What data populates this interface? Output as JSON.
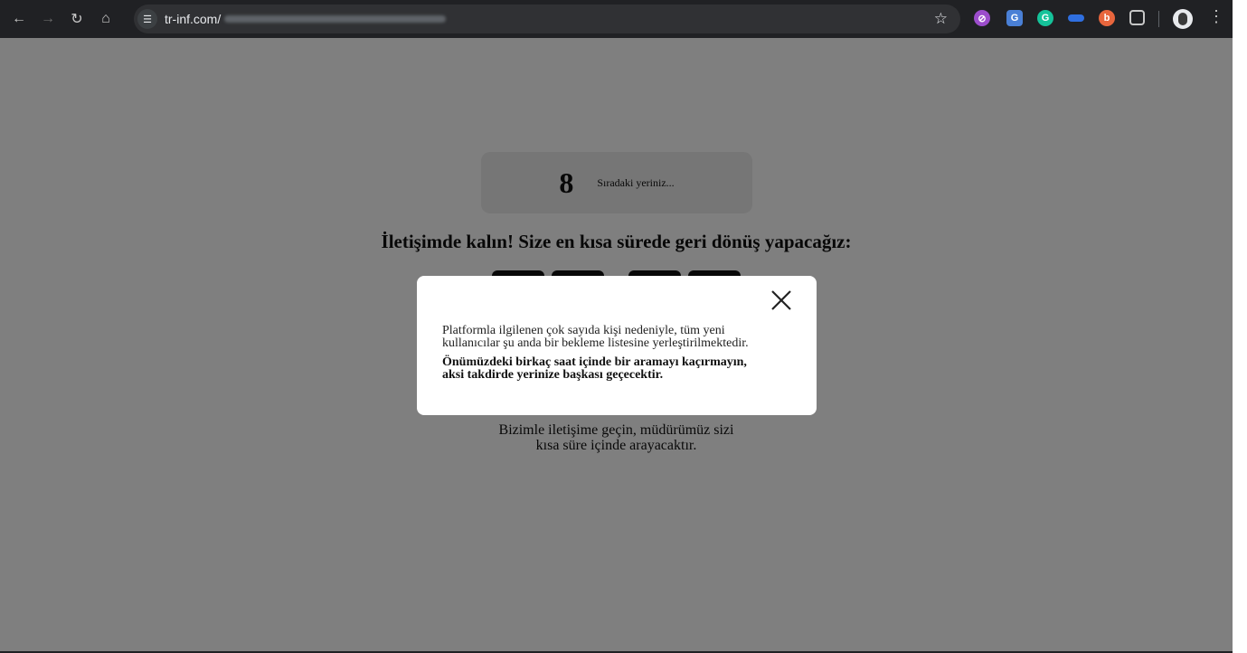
{
  "browser": {
    "url_host": "tr-inf.com/",
    "icons": [
      "back-icon",
      "forward-icon",
      "reload-icon",
      "home-icon",
      "site-settings-icon",
      "bookmark-star-icon",
      "extensions-icon",
      "profile-avatar",
      "menu-kebab-icon"
    ]
  },
  "page": {
    "queue_number": "8",
    "queue_text": "Sıradaki yeriniz...",
    "headline": "İletişimde kalın! Size en kısa sürede geri dönüş yapacağız:",
    "contact_line_1": "Bizimle iletişime geçin, müdürümüz sizi",
    "contact_line_2": "kısa süre içinde arayacaktır."
  },
  "modal": {
    "paragraph_1_line_1": "Platformla ilgilenen çok sayıda kişi nedeniyle, tüm yeni",
    "paragraph_1_line_2": "kullanıcılar şu anda bir bekleme listesine yerleştirilmektedir.",
    "paragraph_2_line_1": "Önümüzdeki birkaç saat içinde bir aramayı kaçırmayın,",
    "paragraph_2_line_2": "aksi takdirde yerinize başkası geçecektir."
  },
  "colors": {
    "chrome_bg": "#202124",
    "overlay": "rgba(0,0,0,0.5)"
  }
}
